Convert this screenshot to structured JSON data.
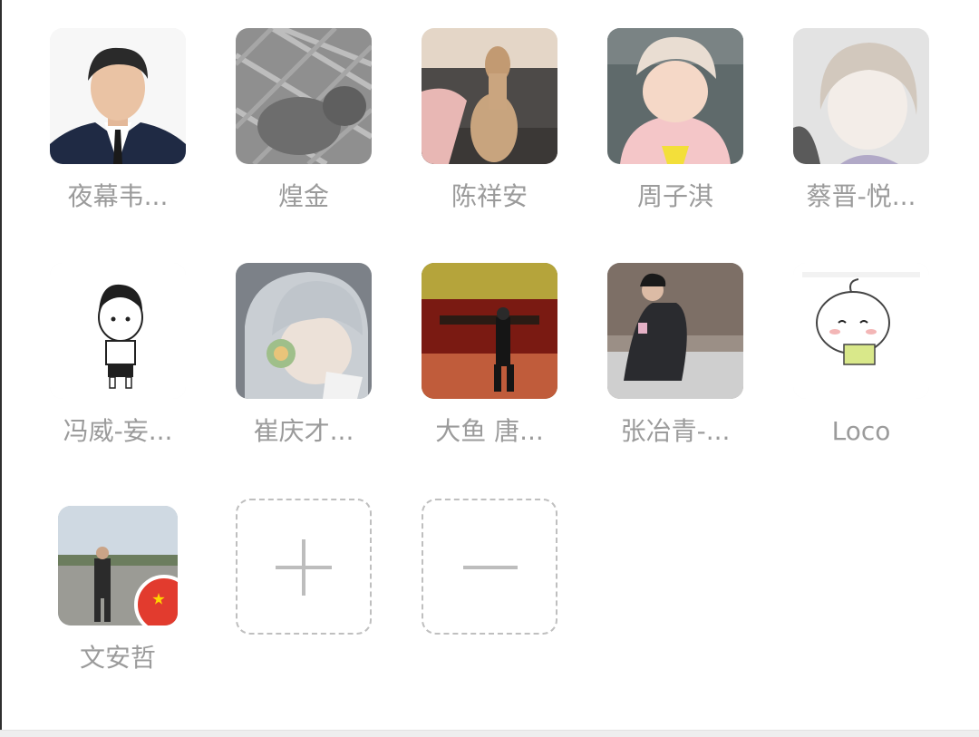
{
  "members": [
    {
      "name": "夜幕韦..."
    },
    {
      "name": "煌金"
    },
    {
      "name": "陈祥安"
    },
    {
      "name": "周子淇"
    },
    {
      "name": "蔡晋-悦..."
    },
    {
      "name": "冯威-妄..."
    },
    {
      "name": "崔庆才..."
    },
    {
      "name": "大鱼 唐..."
    },
    {
      "name": "张冶青-..."
    },
    {
      "name": "Loco"
    },
    {
      "name": "文安哲"
    }
  ],
  "actions": {
    "add_icon": "plus-icon",
    "remove_icon": "minus-icon"
  },
  "colors": {
    "name_text": "#9b9b9b",
    "dashed_border": "#bfbfbf",
    "badge_red": "#e23b2e"
  }
}
